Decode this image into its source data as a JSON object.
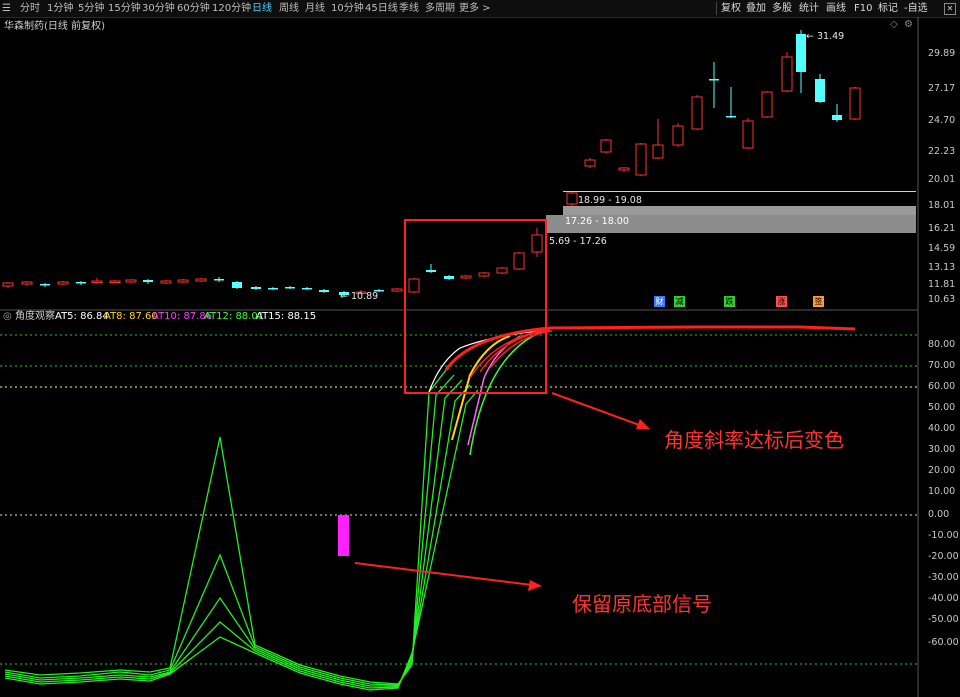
{
  "toolbar": {
    "left_items": [
      "分时",
      "1分钟",
      "5分钟",
      "15分钟",
      "30分钟",
      "60分钟",
      "120分钟",
      "日线",
      "周线",
      "月线",
      "10分钟",
      "45日线",
      "季线",
      "多周期",
      "更多 >"
    ],
    "active_item": "日线",
    "right_items": [
      "复权",
      "叠加",
      "多股",
      "统计",
      "画线",
      "F10",
      "标记",
      "-自选"
    ]
  },
  "stock_title": "华森制药(日线 前复权)",
  "price_axis": [
    "29.89",
    "27.17",
    "24.70",
    "22.23",
    "20.01",
    "18.01",
    "16.21",
    "14.59",
    "13.13",
    "11.81",
    "10.63"
  ],
  "indicator_axis": [
    "80.00",
    "70.00",
    "60.00",
    "50.00",
    "40.00",
    "30.00",
    "20.00",
    "10.00",
    "0.00",
    "-10.00",
    "-20.00",
    "-30.00",
    "-40.00",
    "-50.00",
    "-60.00"
  ],
  "price_high_label": "31.49",
  "price_low_label": "10.89",
  "cost_ranges": [
    "18.99 - 19.08",
    "17.26 - 18.00",
    "5.69 - 17.26"
  ],
  "event_tags": [
    "财",
    "减",
    "跌",
    "涨",
    "签"
  ],
  "indicator": {
    "name": "角度观察",
    "values": [
      {
        "label": "AT5: 86.84",
        "color": "#ffffff"
      },
      {
        "label": "AT8: 87.60",
        "color": "#ffd700"
      },
      {
        "label": "AT10: 87.86",
        "color": "#ff3cff"
      },
      {
        "label": "AT12: 88.01",
        "color": "#33ff33"
      },
      {
        "label": "AT15: 88.15",
        "color": "#ffffff"
      }
    ]
  },
  "annotations": {
    "angle": "角度斜率达标后变色",
    "bottom": "保留原底部信号"
  },
  "colors": {
    "up_candle": "#ff3030",
    "down_candle": "#54ffff",
    "indicator_line": "#22ee22",
    "signal_bar": "#ff22ff",
    "highlight_box": "#ff2020"
  }
}
